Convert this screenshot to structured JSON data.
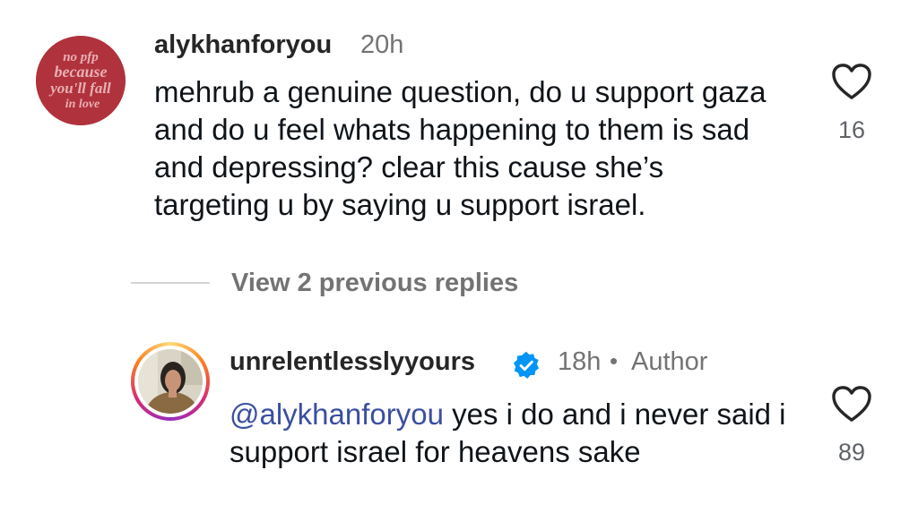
{
  "comment1": {
    "avatar_text": [
      "no pfp",
      "because",
      "you'll fall",
      "in love"
    ],
    "username": "alykhanforyou",
    "time": "20h",
    "text": "mehrub a genuine question, do u support gaza and do u feel whats happening to them is sad and depressing? clear this cause she’s targeting u by saying u support israel.",
    "likes": "16"
  },
  "view_previous_replies": "View 2 previous replies",
  "reply1": {
    "username": "unrelentlesslyyours",
    "time": "18h",
    "separator": "•",
    "author_label": "Author",
    "mention": "@alykhanforyou",
    "text": "yes i do and i never said i support israel for heavens sake",
    "likes": "89"
  },
  "colors": {
    "avatar_red": "#b0323d",
    "verified_blue": "#0095f6",
    "mention_blue": "#3a4fa0",
    "muted_gray": "#737373"
  }
}
